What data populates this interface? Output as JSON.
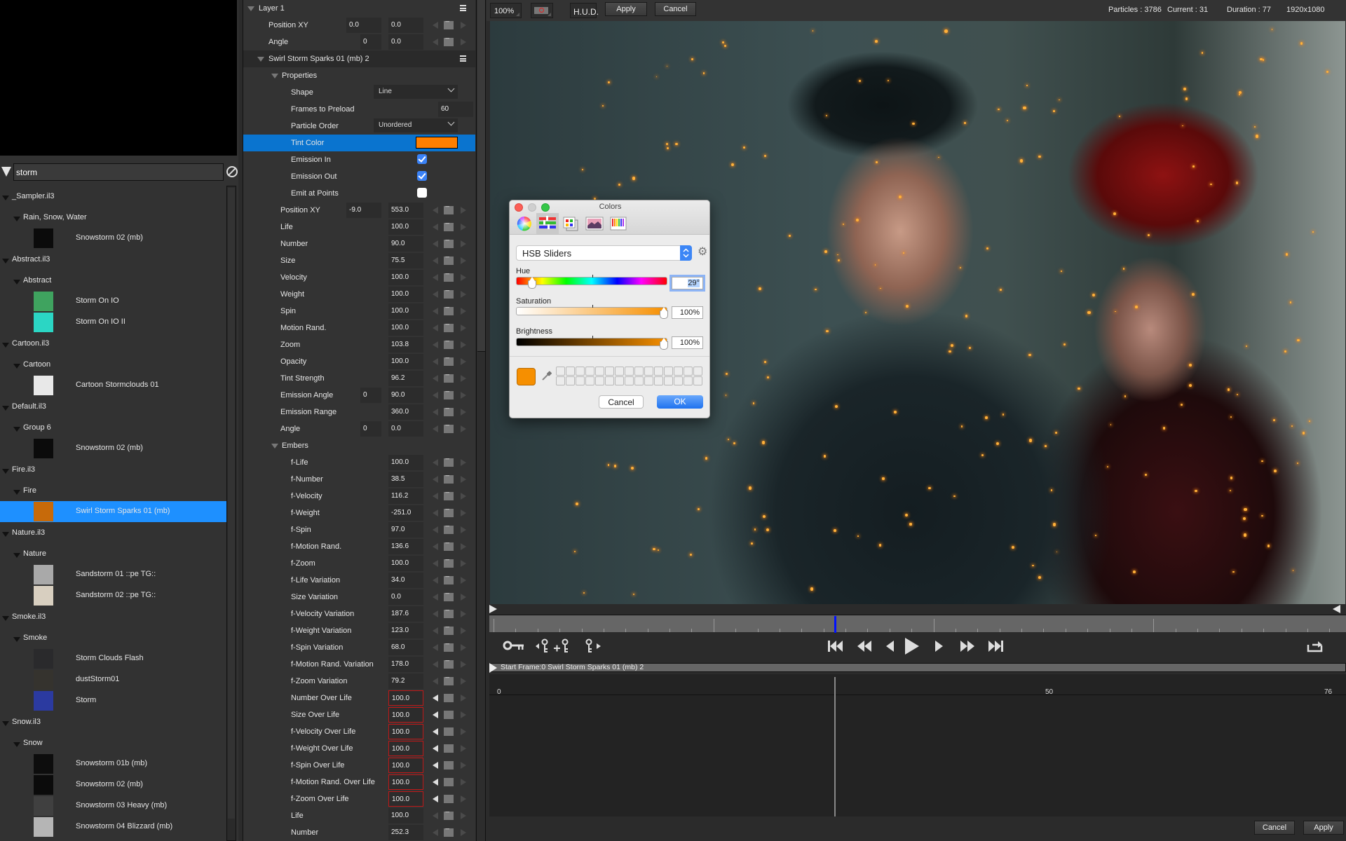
{
  "library": {
    "search_value": "storm",
    "items": [
      {
        "type": "file",
        "label": "_Sampler.il3"
      },
      {
        "type": "group",
        "label": "Rain, Snow, Water"
      },
      {
        "type": "item",
        "label": "Snowstorm 02 (mb)",
        "thumb": "#0b0b0b"
      },
      {
        "type": "file",
        "label": "Abstract.il3"
      },
      {
        "type": "group",
        "label": "Abstract"
      },
      {
        "type": "item",
        "label": "Storm On IO",
        "thumb": "#3fa35f"
      },
      {
        "type": "item",
        "label": "Storm On IO II",
        "thumb": "#2bd6c4"
      },
      {
        "type": "file",
        "label": "Cartoon.il3"
      },
      {
        "type": "group",
        "label": "Cartoon"
      },
      {
        "type": "item",
        "label": "Cartoon Stormclouds 01",
        "thumb": "#e8e8e8"
      },
      {
        "type": "file",
        "label": "Default.il3"
      },
      {
        "type": "group",
        "label": "Group 6"
      },
      {
        "type": "item",
        "label": "Snowstorm 02 (mb)",
        "thumb": "#0b0b0b"
      },
      {
        "type": "file",
        "label": "Fire.il3"
      },
      {
        "type": "group",
        "label": "Fire"
      },
      {
        "type": "item",
        "label": "Swirl Storm Sparks 01 (mb)",
        "thumb": "#c76a0a",
        "selected": true
      },
      {
        "type": "file",
        "label": "Nature.il3"
      },
      {
        "type": "group",
        "label": "Nature"
      },
      {
        "type": "item",
        "label": "Sandstorm 01  ::pe TG::",
        "thumb": "#a9a9a9"
      },
      {
        "type": "item",
        "label": "Sandstorm 02  ::pe TG::",
        "thumb": "#d8cfc0"
      },
      {
        "type": "file",
        "label": "Smoke.il3"
      },
      {
        "type": "group",
        "label": "Smoke"
      },
      {
        "type": "item",
        "label": "Storm Clouds Flash",
        "thumb": "#2a2a2c"
      },
      {
        "type": "item",
        "label": "dustStorm01",
        "thumb": "#35332e"
      },
      {
        "type": "item",
        "label": "Storm",
        "thumb": "#2b3aa0"
      },
      {
        "type": "file",
        "label": "Snow.il3"
      },
      {
        "type": "group",
        "label": "Snow"
      },
      {
        "type": "item",
        "label": "Snowstorm 01b (mb)",
        "thumb": "#0d0d0d"
      },
      {
        "type": "item",
        "label": "Snowstorm 02 (mb)",
        "thumb": "#0b0b0b"
      },
      {
        "type": "item",
        "label": "Snowstorm 03 Heavy (mb)",
        "thumb": "#404040"
      },
      {
        "type": "item",
        "label": "Snowstorm 04 Blizzard (mb)",
        "thumb": "#b5b5b5"
      }
    ]
  },
  "properties": {
    "rows": [
      {
        "kind": "header",
        "indent": 0,
        "label": "Layer 1",
        "menu": true
      },
      {
        "kind": "param",
        "indent": 1,
        "label": "Position XY",
        "v1": "0.0",
        "v2": "0.0"
      },
      {
        "kind": "param",
        "indent": 1,
        "label": "Angle",
        "v1s": "0",
        "v2": "0.0"
      },
      {
        "kind": "header",
        "indent": 1,
        "label": "Swirl Storm Sparks 01 (mb) 2",
        "menu": true
      },
      {
        "kind": "group",
        "indent": 2,
        "label": "Properties"
      },
      {
        "kind": "select",
        "indent": 3,
        "label": "Shape",
        "value": "Line"
      },
      {
        "kind": "frames",
        "indent": 3,
        "label": "Frames to Preload",
        "value": "60"
      },
      {
        "kind": "select",
        "indent": 3,
        "label": "Particle Order",
        "value": "Unordered"
      },
      {
        "kind": "color",
        "indent": 3,
        "label": "Tint Color",
        "value": "#ff7f00",
        "selected": true
      },
      {
        "kind": "check",
        "indent": 3,
        "label": "Emission In",
        "checked": true
      },
      {
        "kind": "check",
        "indent": 3,
        "label": "Emission Out",
        "checked": true
      },
      {
        "kind": "check",
        "indent": 3,
        "label": "Emit at Points",
        "checked": false
      },
      {
        "kind": "param",
        "indent": 2,
        "label": "Position XY",
        "v1": "-9.0",
        "v2": "553.0"
      },
      {
        "kind": "param",
        "indent": 2,
        "label": "Life",
        "v2": "100.0"
      },
      {
        "kind": "param",
        "indent": 2,
        "label": "Number",
        "v2": "90.0"
      },
      {
        "kind": "param",
        "indent": 2,
        "label": "Size",
        "v2": "75.5"
      },
      {
        "kind": "param",
        "indent": 2,
        "label": "Velocity",
        "v2": "100.0"
      },
      {
        "kind": "param",
        "indent": 2,
        "label": "Weight",
        "v2": "100.0"
      },
      {
        "kind": "param",
        "indent": 2,
        "label": "Spin",
        "v2": "100.0"
      },
      {
        "kind": "param",
        "indent": 2,
        "label": "Motion Rand.",
        "v2": "100.0"
      },
      {
        "kind": "param",
        "indent": 2,
        "label": "Zoom",
        "v2": "103.8"
      },
      {
        "kind": "param",
        "indent": 2,
        "label": "Opacity",
        "v2": "100.0"
      },
      {
        "kind": "param",
        "indent": 2,
        "label": "Tint Strength",
        "v2": "96.2"
      },
      {
        "kind": "param",
        "indent": 2,
        "label": "Emission Angle",
        "v1s": "0",
        "v2": "90.0"
      },
      {
        "kind": "param",
        "indent": 2,
        "label": "Emission Range",
        "v2": "360.0"
      },
      {
        "kind": "param",
        "indent": 2,
        "label": "Angle",
        "v1s": "0",
        "v2": "0.0"
      },
      {
        "kind": "group",
        "indent": 2,
        "label": "Embers"
      },
      {
        "kind": "param",
        "indent": 3,
        "label": "f-Life",
        "v2": "100.0"
      },
      {
        "kind": "param",
        "indent": 3,
        "label": "f-Number",
        "v2": "38.5"
      },
      {
        "kind": "param",
        "indent": 3,
        "label": "f-Velocity",
        "v2": "116.2"
      },
      {
        "kind": "param",
        "indent": 3,
        "label": "f-Weight",
        "v2": "-251.0"
      },
      {
        "kind": "param",
        "indent": 3,
        "label": "f-Spin",
        "v2": "97.0"
      },
      {
        "kind": "param",
        "indent": 3,
        "label": "f-Motion Rand.",
        "v2": "136.6"
      },
      {
        "kind": "param",
        "indent": 3,
        "label": "f-Zoom",
        "v2": "100.0"
      },
      {
        "kind": "param",
        "indent": 3,
        "label": "f-Life Variation",
        "v2": "34.0"
      },
      {
        "kind": "param",
        "indent": 3,
        "label": "Size Variation",
        "v2": "0.0"
      },
      {
        "kind": "param",
        "indent": 3,
        "label": "f-Velocity Variation",
        "v2": "187.6"
      },
      {
        "kind": "param",
        "indent": 3,
        "label": "f-Weight Variation",
        "v2": "123.0"
      },
      {
        "kind": "param",
        "indent": 3,
        "label": "f-Spin Variation",
        "v2": "68.0"
      },
      {
        "kind": "param",
        "indent": 3,
        "label": "f-Motion Rand. Variation",
        "v2": "178.0"
      },
      {
        "kind": "param",
        "indent": 3,
        "label": "f-Zoom Variation",
        "v2": "79.2"
      },
      {
        "kind": "overlife",
        "indent": 3,
        "label": "Number Over Life",
        "v2": "100.0"
      },
      {
        "kind": "overlife",
        "indent": 3,
        "label": "Size Over Life",
        "v2": "100.0"
      },
      {
        "kind": "overlife",
        "indent": 3,
        "label": "f-Velocity Over Life",
        "v2": "100.0"
      },
      {
        "kind": "overlife",
        "indent": 3,
        "label": "f-Weight Over Life",
        "v2": "100.0"
      },
      {
        "kind": "overlife",
        "indent": 3,
        "label": "f-Spin Over Life",
        "v2": "100.0"
      },
      {
        "kind": "overlife",
        "indent": 3,
        "label": "f-Motion Rand. Over Life",
        "v2": "100.0"
      },
      {
        "kind": "overlife",
        "indent": 3,
        "label": "f-Zoom Over Life",
        "v2": "100.0"
      },
      {
        "kind": "param",
        "indent": 3,
        "label": "Life",
        "v2": "100.0"
      },
      {
        "kind": "param",
        "indent": 3,
        "label": "Number",
        "v2": "252.3"
      }
    ]
  },
  "viewer": {
    "zoom": "100%",
    "hud_label": "H.U.D.",
    "apply_label": "Apply",
    "cancel_label": "Cancel",
    "stats": {
      "particles": "Particles : 3786",
      "current": "Current : 31",
      "duration": "Duration : 77",
      "resolution": "1920x1080"
    }
  },
  "timeline": {
    "current_frame": 31,
    "duration": 77,
    "track_label": "Start Frame:0 Swirl Storm Sparks 01 (mb) 2",
    "markers": [
      "0",
      "50",
      "76"
    ]
  },
  "bottom": {
    "cancel_label": "Cancel",
    "apply_label": "Apply"
  },
  "colors_dialog": {
    "title": "Colors",
    "mode": "HSB Sliders",
    "hue_label": "Hue",
    "hue_value": "29°",
    "hue_fraction": 0.08,
    "saturation_label": "Saturation",
    "saturation_value": "100%",
    "saturation_fraction": 1.0,
    "brightness_label": "Brightness",
    "brightness_value": "100%",
    "brightness_fraction": 1.0,
    "current_color": "#f68f00",
    "cancel_label": "Cancel",
    "ok_label": "OK"
  }
}
